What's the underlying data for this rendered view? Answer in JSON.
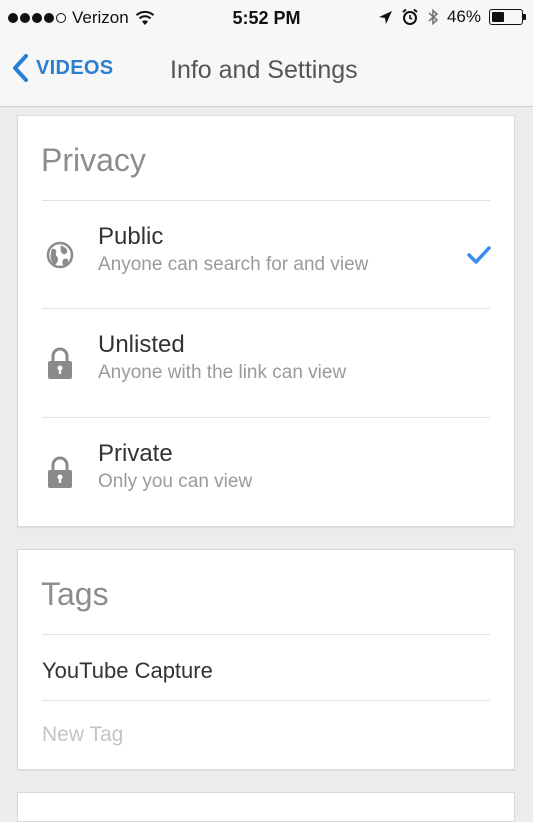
{
  "status_bar": {
    "carrier": "Verizon",
    "time": "5:52 PM",
    "battery_text": "46%",
    "battery_level": 0.46,
    "icons": [
      "signal-dots-icon",
      "wifi-icon",
      "location-icon",
      "alarm-icon",
      "bluetooth-icon",
      "battery-icon"
    ]
  },
  "nav": {
    "back_label": "VIDEOS",
    "title": "Info and Settings",
    "accent": "#2b7fd3"
  },
  "privacy": {
    "title": "Privacy",
    "options": [
      {
        "title": "Public",
        "subtitle": "Anyone can search for and view",
        "icon": "globe-icon",
        "selected": true
      },
      {
        "title": "Unlisted",
        "subtitle": "Anyone with the link can view",
        "icon": "lock-icon",
        "selected": false
      },
      {
        "title": "Private",
        "subtitle": "Only you can view",
        "icon": "lock-icon",
        "selected": false
      }
    ]
  },
  "tags": {
    "title": "Tags",
    "items": [
      "YouTube Capture"
    ],
    "new_tag_placeholder": "New Tag"
  },
  "colors": {
    "check": "#3a8ee6",
    "icon_gray": "#8a8a8a"
  }
}
